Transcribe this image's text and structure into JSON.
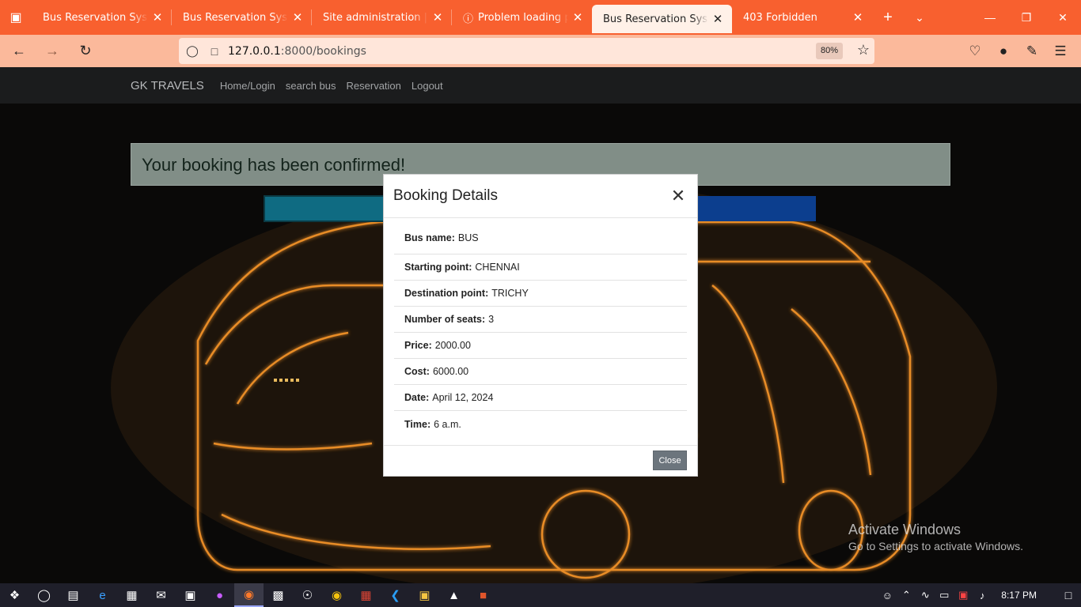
{
  "browser": {
    "tabs": [
      {
        "label": "Bus Reservation System in",
        "active": false
      },
      {
        "label": "Bus Reservation System in",
        "active": false
      },
      {
        "label": "Site administration | Django",
        "active": false
      },
      {
        "label": "Problem loading page",
        "active": false,
        "icon": "info-icon"
      },
      {
        "label": "Bus Reservation System in",
        "active": true
      },
      {
        "label": "403 Forbidden",
        "active": false
      }
    ],
    "url": {
      "host": "127.0.0.1",
      "rest": ":8000/bookings"
    },
    "zoom": "80%",
    "colors": {
      "tabstrip": "#f8602f",
      "toolbar": "#fbb99b"
    }
  },
  "site": {
    "brand": "GK TRAVELS",
    "nav": [
      "Home/Login",
      "search bus",
      "Reservation",
      "Logout"
    ]
  },
  "alert": {
    "message": "Your booking has been confirmed!"
  },
  "modal": {
    "title": "Booking Details",
    "close_label": "Close",
    "details": [
      {
        "label": "Bus name:",
        "value": "BUS"
      },
      {
        "label": "Starting point:",
        "value": "CHENNAI"
      },
      {
        "label": "Destination point:",
        "value": "TRICHY"
      },
      {
        "label": "Number of seats:",
        "value": "3"
      },
      {
        "label": "Price:",
        "value": "2000.00"
      },
      {
        "label": "Cost:",
        "value": "6000.00"
      },
      {
        "label": "Date:",
        "value": "April 12, 2024"
      },
      {
        "label": "Time:",
        "value": "6 a.m."
      }
    ]
  },
  "watermark": {
    "line1": "Activate Windows",
    "line2": "Go to Settings to activate Windows."
  },
  "taskbar": {
    "clock": "8:17 PM"
  }
}
